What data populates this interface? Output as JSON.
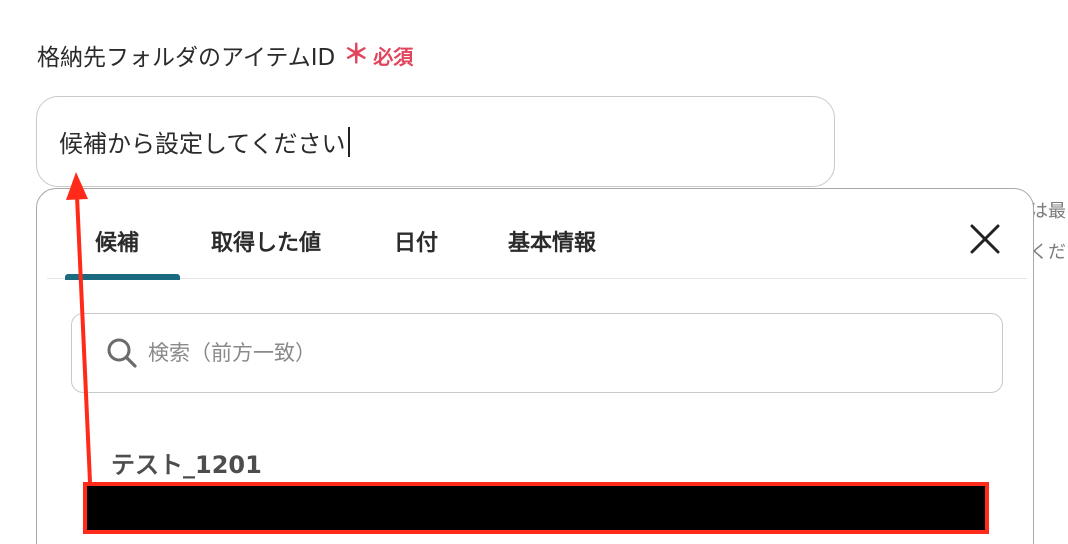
{
  "field": {
    "label": "格納先フォルダのアイテムID",
    "required_mark": "＊",
    "required_text": "必須"
  },
  "input": {
    "placeholder": "候補から設定してください"
  },
  "background_peek": [
    "は最",
    "くだ"
  ],
  "dropdown": {
    "tabs": [
      {
        "label": "候補",
        "active": true
      },
      {
        "label": "取得した値",
        "active": false
      },
      {
        "label": "日付",
        "active": false
      },
      {
        "label": "基本情報",
        "active": false
      }
    ],
    "close_icon": "close-icon",
    "search": {
      "icon": "search-icon",
      "placeholder": "検索（前方一致）"
    },
    "options": [
      {
        "label": "テスト_1201"
      }
    ]
  },
  "colors": {
    "required": "#e2445c",
    "tab_active_underline": "#1a6a80",
    "annotation": "#ff2a1a"
  }
}
